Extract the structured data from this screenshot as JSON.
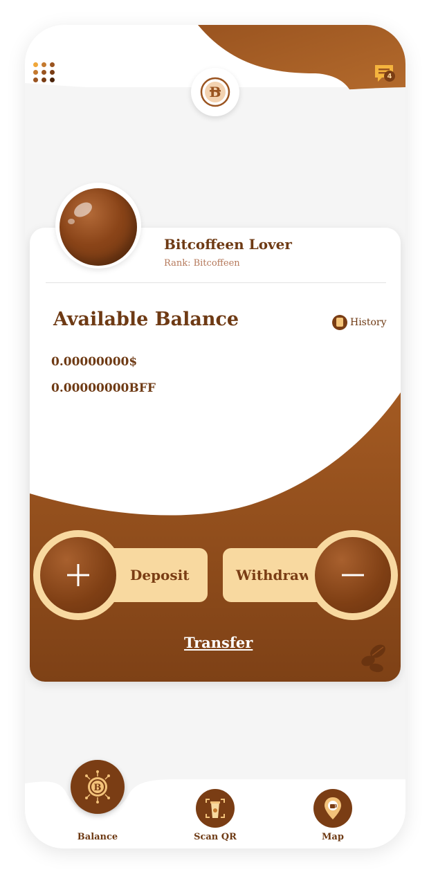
{
  "header": {
    "menu_icon": "dots-grid-icon",
    "logo_icon": "bitcoffee-logo-icon",
    "messages_icon": "chat-icon",
    "messages_badge": "4"
  },
  "profile": {
    "name": "Bitcoffeen Lover",
    "rank": "Rank: Bitcoffeen"
  },
  "balance": {
    "title": "Available Balance",
    "history_label": "History",
    "usd": "0.00000000$",
    "bff": "0.00000000BFF"
  },
  "actions": {
    "deposit_label": "Deposit",
    "withdraw_label": "Withdraw",
    "transfer_label": "Transfer"
  },
  "nav": {
    "items": [
      {
        "label": "Balance",
        "icon": "bitcoffee-coin-icon",
        "active": true
      },
      {
        "label": "Scan QR",
        "icon": "coffee-cup-qr-icon",
        "active": false
      },
      {
        "label": "Map",
        "icon": "map-pin-coffee-icon",
        "active": false
      }
    ]
  },
  "colors": {
    "brown_dark": "#7a3d14",
    "brown": "#8f4c1c",
    "cream": "#f8d9a0",
    "background": "#f5f5f5"
  }
}
